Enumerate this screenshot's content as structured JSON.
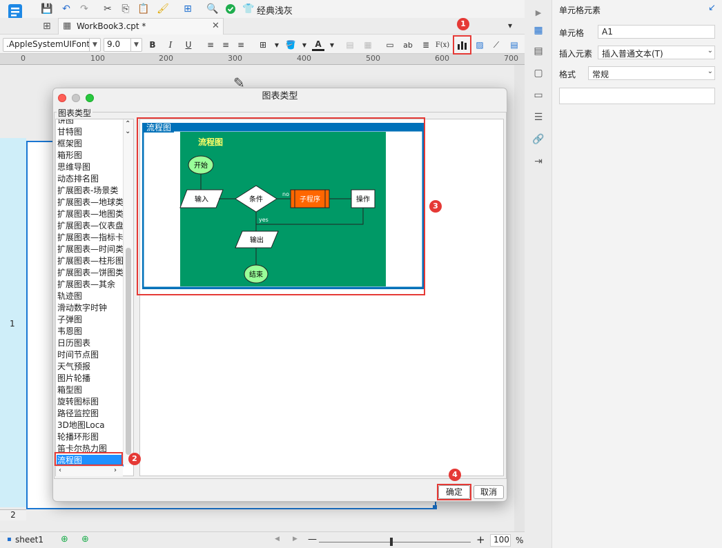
{
  "toolbar": {
    "theme_label": "经典浅灰"
  },
  "tab": {
    "title": "WorkBook3.cpt *"
  },
  "format_bar": {
    "font_name": ".AppleSystemUIFont",
    "font_size": "9.0",
    "bold": "B",
    "italic": "I",
    "underline": "U",
    "abc": "ab",
    "formula": "F(x)"
  },
  "ruler": {
    "ticks": [
      "0",
      "100",
      "200",
      "300",
      "400",
      "500",
      "600",
      "700"
    ]
  },
  "row_headers": {
    "row1": "1",
    "row2": "2"
  },
  "right_panel": {
    "title": "单元格元素",
    "cell_label": "单元格",
    "cell_value": "A1",
    "insert_label": "插入元素",
    "insert_value": "插入普通文本(T)",
    "format_label": "格式",
    "format_value": "常规"
  },
  "dialog": {
    "title": "图表类型",
    "group_label": "图表类型",
    "list_items": [
      "饼图",
      "甘特图",
      "框架图",
      "箱形图",
      "思维导图",
      "动态排名图",
      "扩展图表-场景类",
      "扩展图表—地球类",
      "扩展图表—地图类",
      "扩展图表—仪表盘",
      "扩展图表—指标卡",
      "扩展图表—时间类",
      "扩展图表—柱形图",
      "扩展图表—饼图类",
      "扩展图表—其余",
      "轨迹图",
      "滑动数字时钟",
      "子弹图",
      "韦恩图",
      "日历图表",
      "时间节点图",
      "天气预报",
      "图片轮播",
      "箱型图",
      "旋转图标图",
      "路径监控图",
      "3D地图Loca",
      "轮播环形图",
      "笛卡尔热力图",
      "流程图"
    ],
    "selected_item": "流程图",
    "preview_title": "流程图",
    "preview_heading": "流程图",
    "flow": {
      "start": "开始",
      "input": "输入",
      "condition": "条件",
      "no_label": "no",
      "process": "子程序",
      "operation": "操作",
      "yes_label": "yes",
      "output": "输出",
      "end": "结束"
    },
    "ok_label": "确定",
    "cancel_label": "取消"
  },
  "badges": [
    "1",
    "2",
    "3",
    "4"
  ],
  "status": {
    "sheet_name": "sheet1",
    "zoom_value": "100",
    "zoom_unit": "%",
    "zoom_minus": "—",
    "zoom_plus": "+"
  },
  "colors": {
    "accent": "#1976d2",
    "highlight": "#e53935",
    "preview_frame": "#0071b9",
    "preview_bg": "#009966",
    "start_node": "#99ff99",
    "process_node": "#ff6600",
    "heading": "#ffff66"
  }
}
